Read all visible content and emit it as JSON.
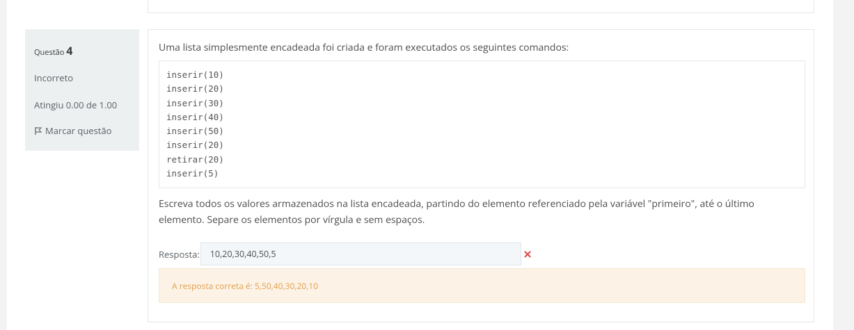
{
  "question": {
    "label": "Questão",
    "number": "4",
    "state": "Incorreto",
    "grade": "Atingiu 0.00 de 1.00",
    "flag_label": "Marcar questão",
    "flag_icon": "flag-icon",
    "text": "Uma lista simplesmente encadeada foi criada e foram executados os seguintes comandos:",
    "code": [
      "inserir(10)",
      "inserir(20)",
      "inserir(30)",
      "inserir(40)",
      "inserir(50)",
      "inserir(20)",
      "retirar(20)",
      "inserir(5)"
    ],
    "instructions": "Escreva todos os valores armazenados na lista encadeada, partindo do elemento referenciado pela variável \"primeiro\", até o último elemento. Separe os elementos por vírgula e sem espaços.",
    "answer_label": "Resposta:",
    "answer_value": "10,20,30,40,50,5",
    "incorrect_icon": "incorrect-icon",
    "feedback": "A resposta correta é: 5,50,40,30,20,10"
  },
  "colors": {
    "info_bg": "#edf0f1",
    "feedback_bg": "#fcf2e6",
    "feedback_text": "#e2a04a",
    "incorrect": "#e24d4d"
  }
}
